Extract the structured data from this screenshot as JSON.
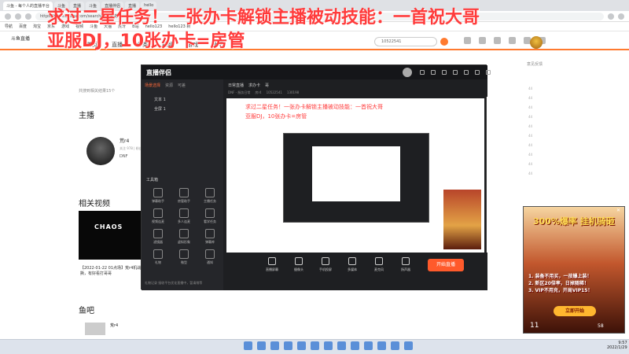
{
  "browser": {
    "tabs": [
      "斗鱼 - 每个人的直播平台",
      "斗鱼",
      "直播",
      "斗鱼",
      "直播伴侣",
      "直播",
      "hello"
    ],
    "url": "https://www.douyu.com/search/?kw=荒r4",
    "bookmarks": [
      "导航",
      "百度",
      "淘宝",
      "京东",
      "游戏",
      "视频",
      "斗鱼",
      "天猫",
      "虎牙",
      "B站",
      "hello123",
      "hello123 新"
    ]
  },
  "overlay": {
    "title": "求过二星任务！一张办卡解锁主播被动技能：一首祝大哥",
    "subtitle": "亚服DJ，10张办卡=房管"
  },
  "site": {
    "logo": "斗鱼直播",
    "nav": [
      "首页",
      "直播",
      "分类",
      "视频",
      "游戏",
      "鱼吧"
    ],
    "search_value": "10522541",
    "feedback": "意见反馈",
    "result_count": "共搜到相关结果15个"
  },
  "sections": {
    "streamer": "主播",
    "video": "相关视频",
    "bar": "鱼吧"
  },
  "streamer": {
    "name": "荒r4",
    "meta": "关注 978 | 粉丝",
    "game": "DNF"
  },
  "video": {
    "logo": "CHAOS",
    "caption": "【2022-01-22 01点场】荒r4机战撕，有好看打哥哥"
  },
  "bar": {
    "name": "荒r4"
  },
  "right_numbers": [
    "44",
    "44",
    "44",
    "44",
    "44",
    "44",
    "44",
    "44",
    "44",
    "44"
  ],
  "app": {
    "title": "直播伴侣",
    "scene_tabs": [
      "场景选择",
      "资源",
      "可差"
    ],
    "sources": [
      "文本 1",
      "全屏 1"
    ],
    "tools_title": "工具箱",
    "tools": [
      "弹幕助手",
      "房管助手",
      "主播任务",
      "视频连麦",
      "多人连麦",
      "看学任务",
      "滤镜器",
      "虚拟形象",
      "弹幕库",
      "礼物",
      "微型",
      "通知"
    ],
    "canvas_tabs": [
      "日常直播",
      "求办卡",
      "哥"
    ],
    "canvas_info": [
      "DNF - 服务日常",
      "房r4",
      "10522541",
      "130198"
    ],
    "bottom_tools": [
      "直播屏幕",
      "摄像头",
      "手机投屏",
      "多媒体",
      "麦克风",
      "扬声器"
    ],
    "go_live": "开始直播",
    "status": "礼物记录 接收平台优化直播中，暂请稍等",
    "mini_title": "求过二星任务！一张办卡解锁主播被动技能：一首祝大哥",
    "mini_sub": "亚服DJ，10张办卡=房管"
  },
  "ad": {
    "title": "300%爆率 挂机骑砸",
    "lines": [
      "1. 装备不用买，一孩爆上装！",
      "2. 新区20倍率，日掉随稀！",
      "3. VIP不用充，开局VIP15！"
    ],
    "start": "立即开始",
    "timer": "11",
    "time": "58"
  },
  "taskbar": {
    "time": "9:57",
    "date": "2022/1/29"
  }
}
